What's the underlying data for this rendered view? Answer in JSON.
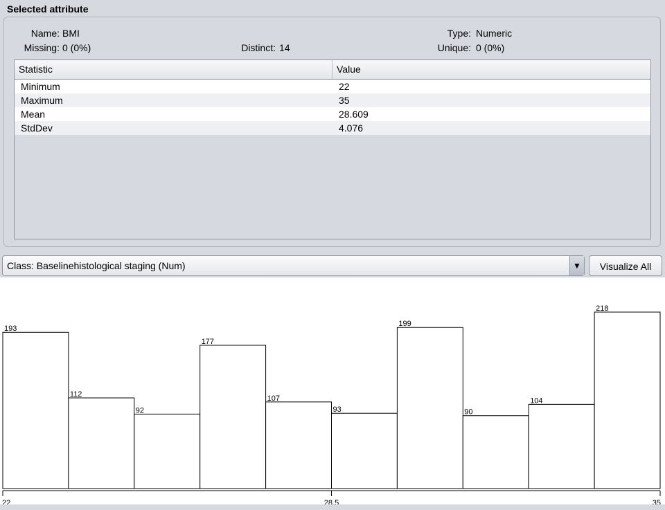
{
  "section_title": "Selected attribute",
  "attribute": {
    "name_label": "Name:",
    "name_value": "BMI",
    "type_label": "Type:",
    "type_value": "Numeric",
    "missing_label": "Missing:",
    "missing_value": "0 (0%)",
    "distinct_label": "Distinct:",
    "distinct_value": "14",
    "unique_label": "Unique:",
    "unique_value": "0 (0%)"
  },
  "stats_table": {
    "headers": [
      "Statistic",
      "Value"
    ],
    "rows": [
      [
        "Minimum",
        "22"
      ],
      [
        "Maximum",
        "35"
      ],
      [
        "Mean",
        "28.609"
      ],
      [
        "StdDev",
        "4.076"
      ]
    ]
  },
  "class_select": {
    "value": "Class: Baselinehistological staging (Num)"
  },
  "visualize_all_label": "Visualize All",
  "chart_data": {
    "type": "bar",
    "values": [
      193,
      112,
      92,
      177,
      107,
      93,
      199,
      90,
      104,
      218
    ],
    "x_tick_labels": [
      "22",
      "28.5",
      "35"
    ],
    "xlim": [
      22,
      35
    ],
    "ylim": [
      0,
      218
    ],
    "grid": false,
    "bar_fill": "#ffffff",
    "bar_stroke": "#000000"
  }
}
